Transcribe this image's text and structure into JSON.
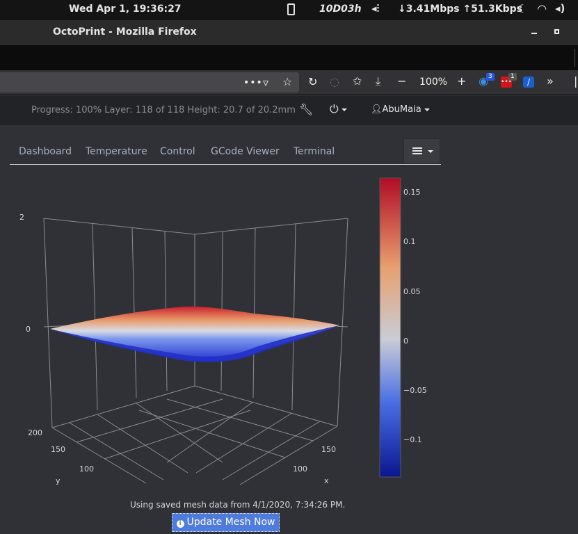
{
  "system_bar": {
    "clock": "Wed Apr  1, 19:36:27",
    "host": "10D03h",
    "network": "↓3.41Mbps ↑51.3Kbps"
  },
  "window": {
    "title": "OctoPrint - Mozilla Firefox"
  },
  "browser": {
    "zoom": "100%",
    "extension_badges": [
      "3",
      "1"
    ]
  },
  "octoprint": {
    "status": "Progress: 100% Layer: 118 of 118 Height: 20.7 of 20.2mm",
    "user": "AbuMaia",
    "tabs": [
      "Dashboard",
      "Temperature",
      "Control",
      "GCode Viewer",
      "Terminal"
    ]
  },
  "mesh": {
    "info_text": "Using saved mesh data from 4/1/2020, 7:34:26 PM.",
    "update_button": "Update Mesh Now"
  },
  "chart_data": {
    "type": "surface",
    "z_axis_ticks": [
      "2",
      "0"
    ],
    "x_axis_ticks": [
      "150",
      "100"
    ],
    "y_axis_ticks": [
      "200",
      "150",
      "100"
    ],
    "x_axis_label": "x",
    "y_axis_label": "y",
    "colorbar": {
      "ticks": [
        "0.15",
        "0.1",
        "0.05",
        "0",
        "−0.05",
        "−0.1"
      ],
      "range": [
        -0.14,
        0.165
      ],
      "colorscale": [
        "#0d1a9e",
        "#4a6fe3",
        "#c8ccd6",
        "#e89a6a",
        "#b40c26"
      ]
    }
  }
}
